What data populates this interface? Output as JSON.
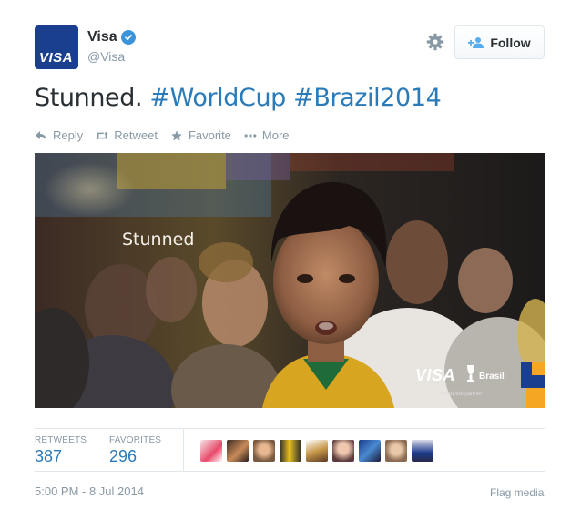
{
  "account": {
    "fullname": "Visa",
    "screenname": "@Visa",
    "avatar_text": "VISA"
  },
  "follow": {
    "label": "Follow"
  },
  "tweet": {
    "text_plain": "Stunned. ",
    "hashtag1": "#WorldCup",
    "hashtag2": "#Brazil2014"
  },
  "actions": {
    "reply": "Reply",
    "retweet": "Retweet",
    "favorite": "Favorite",
    "more": "More"
  },
  "media": {
    "caption": "Stunned",
    "brand": "VISA",
    "cup_label": "Brasil",
    "cup_small": "FIFA WORLD CUP",
    "partner": "worldwide partner"
  },
  "stats": {
    "retweets_label": "RETWEETS",
    "retweets_value": "387",
    "favorites_label": "FAVORITES",
    "favorites_value": "296"
  },
  "footer": {
    "timestamp": "5:00 PM - 8 Jul 2014",
    "flag": "Flag media"
  },
  "colors": {
    "brand_blue": "#1a3f8f",
    "link": "#2b7bb9",
    "muted": "#8899a6",
    "verified": "#3b94d9"
  }
}
